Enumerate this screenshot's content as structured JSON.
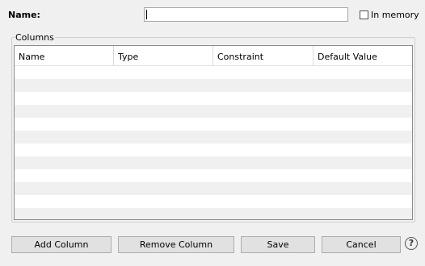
{
  "form": {
    "name_label": "Name:",
    "name_value": "",
    "in_memory_label": "In memory",
    "in_memory_checked": false
  },
  "columns_group": {
    "title": "Columns",
    "headers": [
      "Name",
      "Type",
      "Constraint",
      "Default Value"
    ]
  },
  "buttons": {
    "add_column": "Add Column",
    "remove_column": "Remove Column",
    "save": "Save",
    "cancel": "Cancel",
    "help": "?"
  },
  "icons": {
    "help": "help-icon"
  }
}
